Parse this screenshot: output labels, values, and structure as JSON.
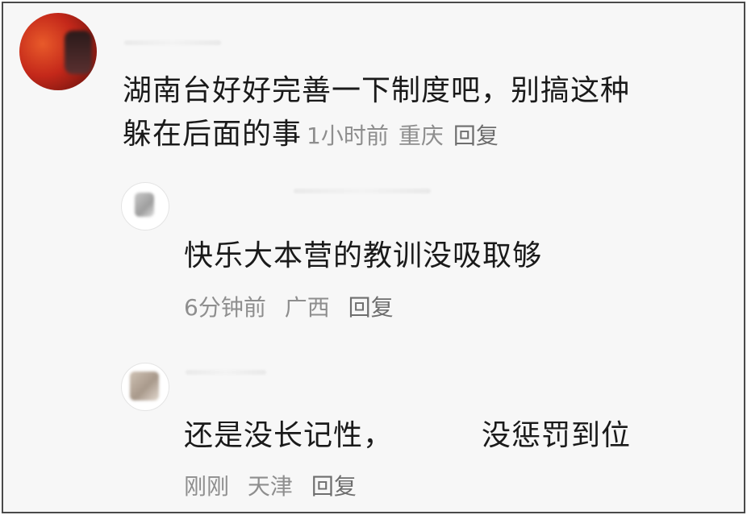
{
  "comments": [
    {
      "text_line1": "湖南台好好完善一下制度吧，别搞这种",
      "text_line2": "躲在后面的事",
      "time": "1小时前",
      "location": "重庆",
      "reply_label": "回复"
    },
    {
      "text": "快乐大本营的教训没吸取够",
      "time": "6分钟前",
      "location": "广西",
      "reply_label": "回复"
    },
    {
      "text_part1": "还是没长记性，",
      "text_part2": "没惩罚到位",
      "time": "刚刚",
      "location": "天津",
      "reply_label": "回复"
    }
  ]
}
